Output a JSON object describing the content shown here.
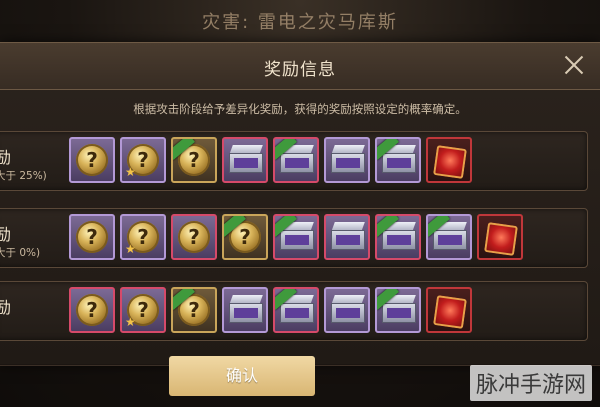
{
  "background_title": "灾害: 雷电之灾马库斯",
  "dialog": {
    "title": "奖励信息",
    "description": "根据攻击阶段给予差异化奖励，获得的奖励按照设定的概率确定。"
  },
  "rows": [
    {
      "label": "励",
      "sub": "大于 25%)",
      "items": [
        {
          "type": "mystery-coin",
          "border": "purple"
        },
        {
          "type": "mystery-coin",
          "border": "purple",
          "star": true
        },
        {
          "type": "mystery-coin",
          "border": "gold",
          "badge": true
        },
        {
          "type": "chest",
          "border": "pink"
        },
        {
          "type": "chest",
          "border": "pink",
          "badge": true
        },
        {
          "type": "chest",
          "border": "purple"
        },
        {
          "type": "chest",
          "border": "purple",
          "badge": true
        },
        {
          "type": "gembox",
          "border": "red"
        }
      ]
    },
    {
      "label": "励",
      "sub": "大于 0%)",
      "items": [
        {
          "type": "mystery-coin",
          "border": "purple"
        },
        {
          "type": "mystery-coin",
          "border": "purple",
          "star": true
        },
        {
          "type": "mystery-coin",
          "border": "pink"
        },
        {
          "type": "mystery-coin",
          "border": "gold",
          "badge": true
        },
        {
          "type": "chest",
          "border": "pink",
          "badge": true
        },
        {
          "type": "chest",
          "border": "pink"
        },
        {
          "type": "chest",
          "border": "pink",
          "badge": true
        },
        {
          "type": "chest",
          "border": "purple",
          "badge": true
        },
        {
          "type": "gembox",
          "border": "red"
        }
      ]
    },
    {
      "label": "励",
      "sub": ")",
      "items": [
        {
          "type": "mystery-coin",
          "border": "pink"
        },
        {
          "type": "mystery-coin",
          "border": "pink",
          "star": true
        },
        {
          "type": "mystery-coin",
          "border": "gold",
          "badge": true
        },
        {
          "type": "chest",
          "border": "purple"
        },
        {
          "type": "chest",
          "border": "pink",
          "badge": true
        },
        {
          "type": "chest",
          "border": "purple"
        },
        {
          "type": "chest",
          "border": "purple",
          "badge": true
        },
        {
          "type": "gembox",
          "border": "red"
        }
      ]
    }
  ],
  "confirm_label": "确认",
  "watermark": "脉冲手游网"
}
